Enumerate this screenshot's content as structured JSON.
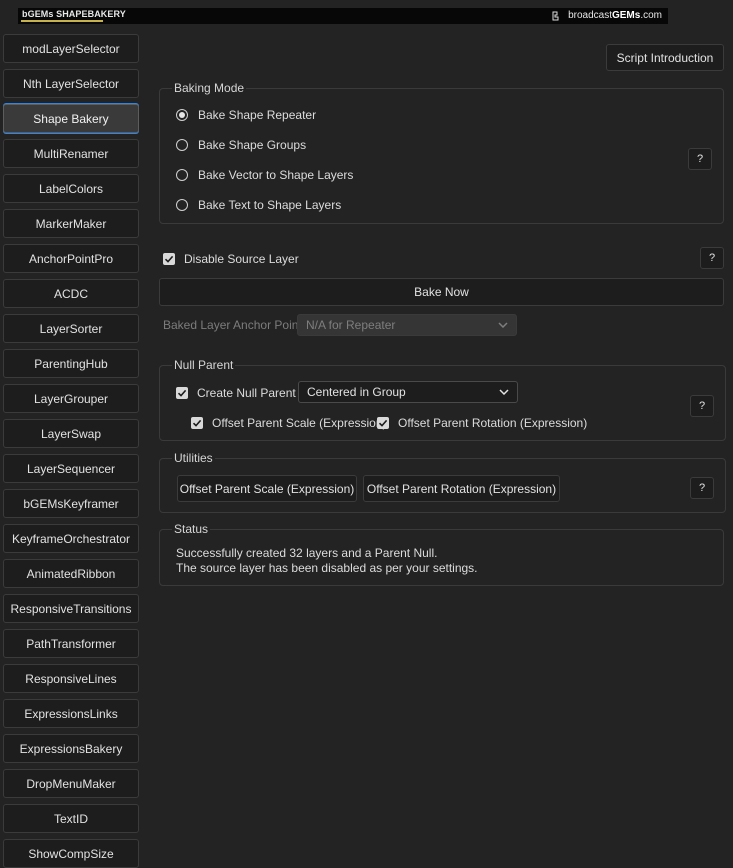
{
  "banner": {
    "brand_text": "bGEMs SHAPEBAKERY",
    "url_prefix": "broadcast",
    "url_bold": "GEMs",
    "url_suffix": ".com"
  },
  "sidebar": {
    "items": [
      {
        "label": "modLayerSelector"
      },
      {
        "label": "Nth LayerSelector"
      },
      {
        "label": "Shape Bakery",
        "active": true
      },
      {
        "label": "MultiRenamer"
      },
      {
        "label": "LabelColors"
      },
      {
        "label": "MarkerMaker"
      },
      {
        "label": "AnchorPointPro"
      },
      {
        "label": "ACDC"
      },
      {
        "label": "LayerSorter"
      },
      {
        "label": "ParentingHub"
      },
      {
        "label": "LayerGrouper"
      },
      {
        "label": "LayerSwap"
      },
      {
        "label": "LayerSequencer"
      },
      {
        "label": "bGEMsKeyframer"
      },
      {
        "label": "KeyframeOrchestrator"
      },
      {
        "label": "AnimatedRibbon"
      },
      {
        "label": "ResponsiveTransitions"
      },
      {
        "label": "PathTransformer"
      },
      {
        "label": "ResponsiveLines"
      },
      {
        "label": "ExpressionsLinks"
      },
      {
        "label": "ExpressionsBakery"
      },
      {
        "label": "DropMenuMaker"
      },
      {
        "label": "TextID"
      },
      {
        "label": "ShowCompSize"
      }
    ]
  },
  "main": {
    "script_intro_label": "Script Introduction",
    "baking_mode": {
      "title": "Baking Mode",
      "options": [
        {
          "label": "Bake Shape Repeater",
          "selected": true
        },
        {
          "label": "Bake Shape Groups",
          "selected": false
        },
        {
          "label": "Bake Vector to Shape Layers",
          "selected": false
        },
        {
          "label": "Bake Text to Shape Layers",
          "selected": false
        }
      ],
      "help_label": "?"
    },
    "disable_source": {
      "label": "Disable Source Layer",
      "checked": true,
      "help_label": "?"
    },
    "bake_now_label": "Bake Now",
    "anchor_point": {
      "label": "Baked Layer Anchor Point:",
      "value": "N/A for Repeater"
    },
    "null_parent": {
      "title": "Null Parent",
      "create_label": "Create Null Parent",
      "create_checked": true,
      "position_value": "Centered in Group",
      "offset_scale_label": "Offset Parent Scale (Expression)",
      "offset_scale_checked": true,
      "offset_rotation_label": "Offset Parent Rotation (Expression)",
      "offset_rotation_checked": true,
      "help_label": "?"
    },
    "utilities": {
      "title": "Utilities",
      "scale_button": "Offset Parent Scale (Expression)",
      "rotation_button": "Offset Parent Rotation (Expression)",
      "help_label": "?"
    },
    "status": {
      "title": "Status",
      "lines": [
        "Successfully created 32 layers and a Parent Null.",
        "The source layer has been disabled as per your settings."
      ]
    }
  }
}
